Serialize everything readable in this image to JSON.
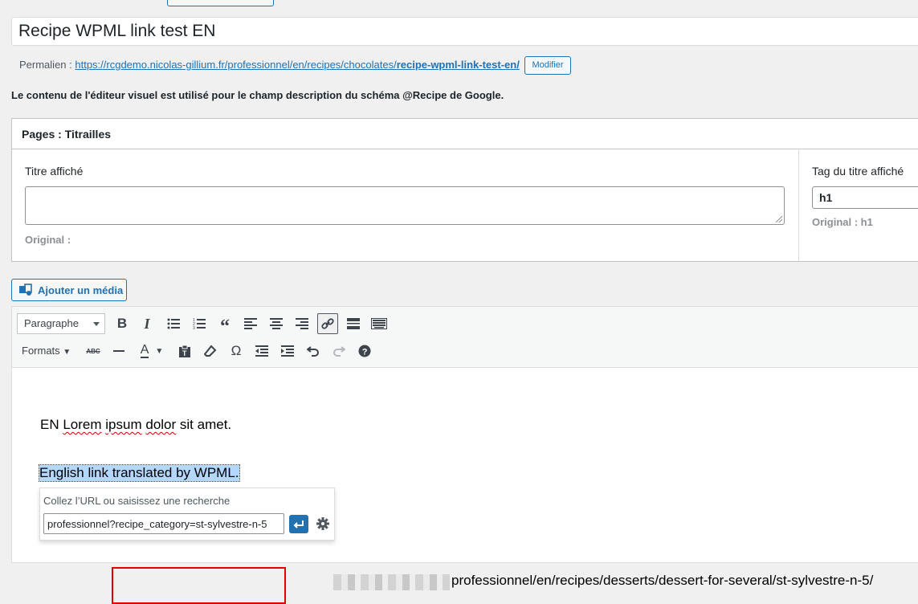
{
  "post_title": "Recipe WPML link test EN",
  "permalink": {
    "label": "Permalien :",
    "url_base": "https://rcgdemo.nicolas-gillium.fr/professionnel/en/recipes/chocolates/",
    "slug": "recipe-wpml-link-test-en/",
    "modify_label": "Modifier"
  },
  "notice": "Le contenu de l'éditeur visuel est utilisé pour le champ description du schéma @Recipe de Google.",
  "metabox": {
    "title": "Pages : Titrailles",
    "displayed_title_label": "Titre affiché",
    "displayed_title_value": "",
    "original_label": "Original :",
    "tag_label": "Tag du titre affiché",
    "tag_value": "h1",
    "tag_original": "Original : h1"
  },
  "add_media_label": "Ajouter un média",
  "editor": {
    "format_select": "Paragraphe",
    "formats_label": "Formats",
    "paragraph1_prefix": "EN ",
    "paragraph1_w1": "Lorem",
    "paragraph1_sp1": " ",
    "paragraph1_w2": "ipsum",
    "paragraph1_sp2": " ",
    "paragraph1_w3": "dolor",
    "paragraph1_suffix": " sit amet.",
    "paragraph2": "English link translated by WPML.",
    "link_popup": {
      "label": "Collez l’URL ou saisissez une recherche",
      "input_value": "professionnel?recipe_category=st-sylvestre-n-5"
    },
    "url_preview": "professionnel/en/recipes/desserts/dessert-for-several/st-sylvestre-n-5/"
  }
}
